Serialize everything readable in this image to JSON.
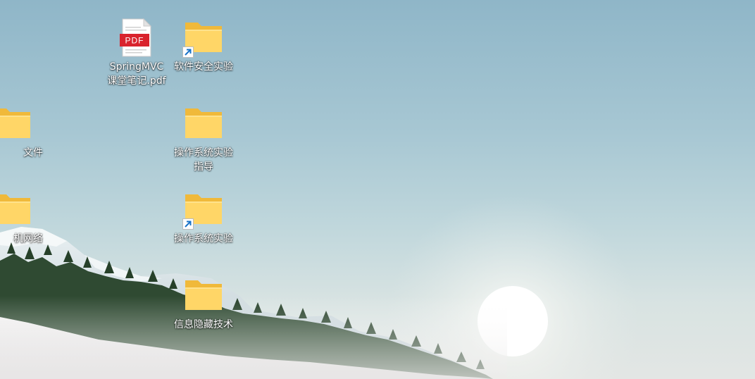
{
  "desktop": {
    "icons": [
      {
        "label": "SpringMVC\n课堂笔记.pdf",
        "icon": "pdf-file-icon",
        "badge": "PDF"
      },
      {
        "label": "软件安全实验",
        "icon": "folder-shortcut-icon"
      },
      {
        "label": "文件",
        "icon": "folder-icon"
      },
      {
        "label": "操作系统实验\n指导",
        "icon": "folder-icon"
      },
      {
        "label": "机网络",
        "icon": "folder-icon"
      },
      {
        "label": "操作系统实验",
        "icon": "folder-shortcut-icon"
      },
      {
        "label": "信息隐藏技术",
        "icon": "folder-icon"
      }
    ]
  },
  "colors": {
    "folder_back": "#f0b93a",
    "folder_front": "#ffd667",
    "pdf_red": "#d9232d",
    "shortcut_arrow": "#1a73c7"
  }
}
